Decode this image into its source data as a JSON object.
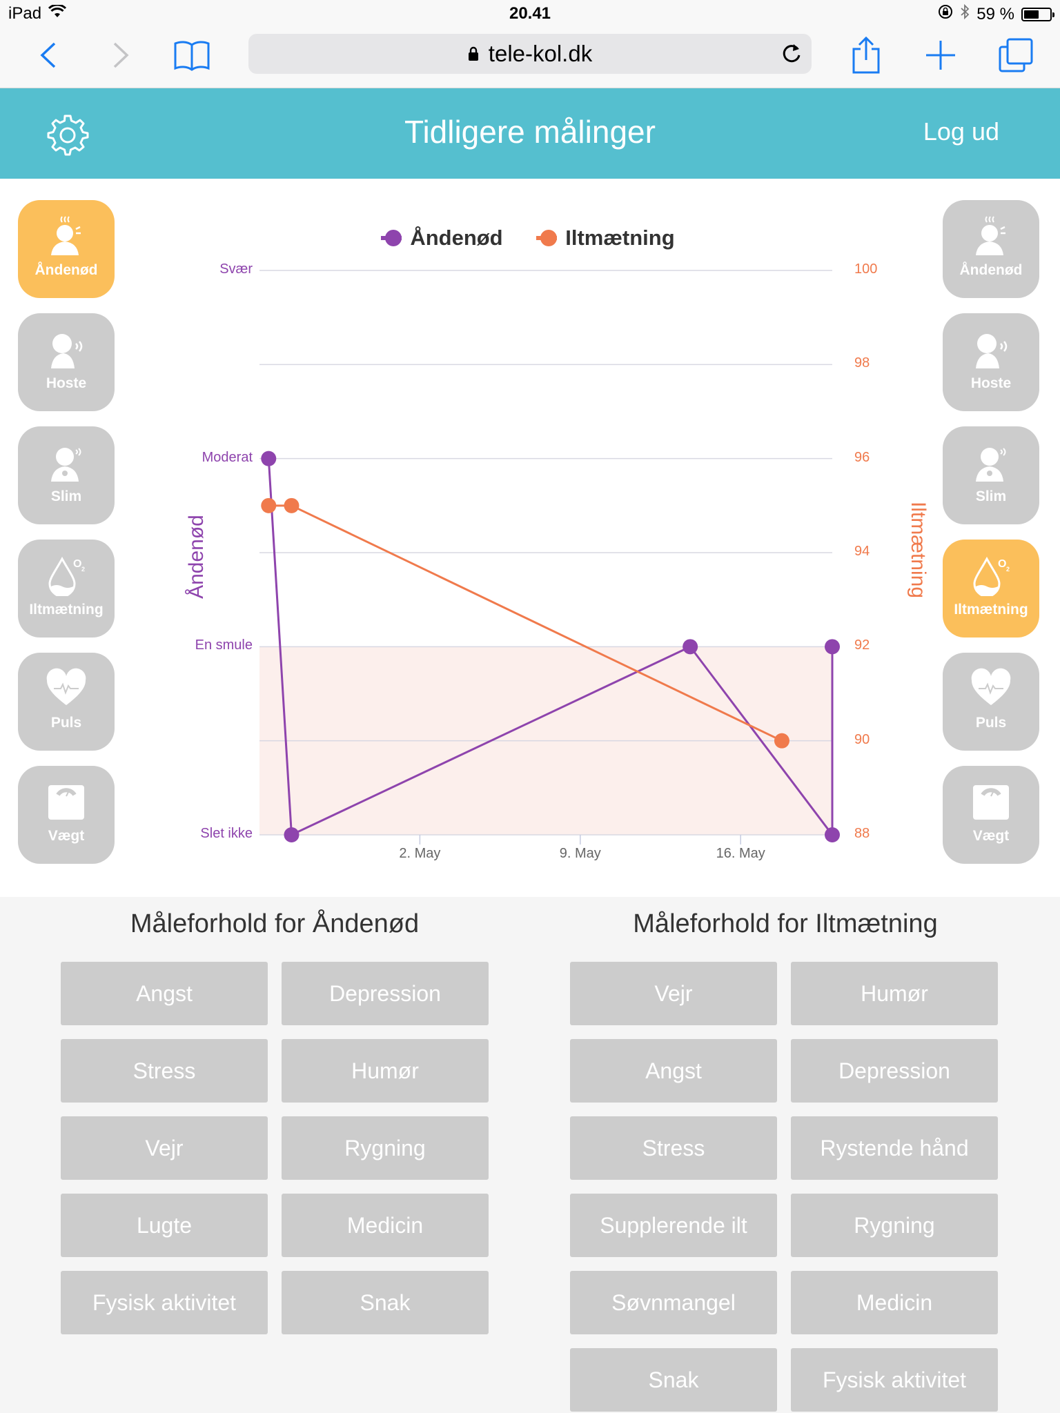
{
  "statusbar": {
    "device": "iPad",
    "time": "20.41",
    "battery": "59 %",
    "battery_level": 0.59
  },
  "browser": {
    "url": "tele-kol.dk"
  },
  "header": {
    "title": "Tidligere målinger",
    "logout": "Log ud"
  },
  "left_buttons": [
    {
      "label": "Åndenød",
      "icon": "breathless-icon",
      "active": true
    },
    {
      "label": "Hoste",
      "icon": "cough-icon",
      "active": false
    },
    {
      "label": "Slim",
      "icon": "mucus-icon",
      "active": false
    },
    {
      "label": "Iltmætning",
      "icon": "oxygen-drop-icon",
      "active": false
    },
    {
      "label": "Puls",
      "icon": "heart-pulse-icon",
      "active": false
    },
    {
      "label": "Vægt",
      "icon": "scale-icon",
      "active": false
    }
  ],
  "right_buttons": [
    {
      "label": "Åndenød",
      "icon": "breathless-icon",
      "active": false
    },
    {
      "label": "Hoste",
      "icon": "cough-icon",
      "active": false
    },
    {
      "label": "Slim",
      "icon": "mucus-icon",
      "active": false
    },
    {
      "label": "Iltmætning",
      "icon": "oxygen-drop-icon",
      "active": true
    },
    {
      "label": "Puls",
      "icon": "heart-pulse-icon",
      "active": false
    },
    {
      "label": "Vægt",
      "icon": "scale-icon",
      "active": false
    }
  ],
  "chart_data": {
    "type": "line",
    "legend": [
      "Åndenød",
      "Iltmætning"
    ],
    "legend_position": "top",
    "y_left": {
      "title": "Åndenød",
      "ticks": [
        "Slet ikke",
        "En smule",
        "Moderat",
        "Svær"
      ],
      "range": [
        0,
        3
      ]
    },
    "y_right": {
      "title": "Iltmætning",
      "ticks": [
        "88",
        "90",
        "92",
        "94",
        "96",
        "98",
        "100"
      ],
      "range": [
        88,
        100
      ]
    },
    "x_ticks": [
      "2. May",
      "9. May",
      "16. May"
    ],
    "x_range_days": [
      -5,
      20
    ],
    "x_tick_days": [
      2,
      9,
      16
    ],
    "normal_band_right": [
      88,
      92
    ],
    "grid": true,
    "colors": {
      "andenod": "#8e44ad",
      "iltmaetning": "#f07a4c",
      "band": "#fcefec"
    },
    "series": [
      {
        "name": "Åndenød",
        "axis": "left",
        "points": [
          [
            -4.6,
            2
          ],
          [
            -3.6,
            0
          ],
          [
            13.8,
            1
          ],
          [
            20.0,
            0
          ],
          [
            20.0,
            1
          ]
        ]
      },
      {
        "name": "Iltmætning",
        "axis": "right",
        "points": [
          [
            -4.6,
            95
          ],
          [
            -3.6,
            95
          ],
          [
            17.8,
            90
          ]
        ]
      }
    ]
  },
  "conditions_left": {
    "title": "Måleforhold for Åndenød",
    "tags": [
      "Angst",
      "Depression",
      "Stress",
      "Humør",
      "Vejr",
      "Rygning",
      "Lugte",
      "Medicin",
      "Fysisk aktivitet",
      "Snak"
    ]
  },
  "conditions_right": {
    "title": "Måleforhold for Iltmætning",
    "tags": [
      "Vejr",
      "Humør",
      "Angst",
      "Depression",
      "Stress",
      "Rystende hånd",
      "Supplerende ilt",
      "Rygning",
      "Søvnmangel",
      "Medicin",
      "Snak",
      "Fysisk aktivitet"
    ]
  }
}
